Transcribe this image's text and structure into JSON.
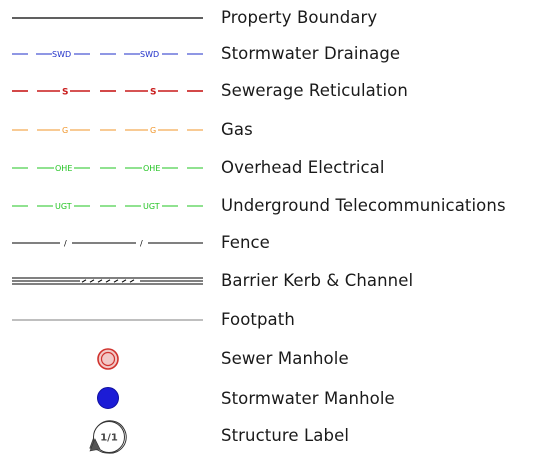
{
  "legend": {
    "items": [
      {
        "id": "property-boundary",
        "label": "Property Boundary",
        "symbol": "solid-line",
        "color": "#000000"
      },
      {
        "id": "stormwater-drainage",
        "label": "Stormwater Drainage",
        "symbol": "dashed-text-line",
        "tag": "SWD",
        "color": "#1f2fc9"
      },
      {
        "id": "sewerage-reticulation",
        "label": "Sewerage Reticulation",
        "symbol": "dashed-text-line",
        "tag": "S",
        "color": "#c81a1a"
      },
      {
        "id": "gas",
        "label": "Gas",
        "symbol": "dashed-text-line",
        "tag": "G",
        "color": "#f0962a"
      },
      {
        "id": "overhead-electrical",
        "label": "Overhead Electrical",
        "symbol": "dashed-text-line",
        "tag": "OHE",
        "color": "#22c422"
      },
      {
        "id": "underground-telecommunications",
        "label": "Underground Telecommunications",
        "symbol": "dashed-text-line",
        "tag": "UGT",
        "color": "#22c422"
      },
      {
        "id": "fence",
        "label": "Fence",
        "symbol": "fence-line",
        "tag": "/",
        "color": "#000000"
      },
      {
        "id": "barrier-kerb",
        "label": "Barrier Kerb & Channel",
        "symbol": "kerb-line",
        "color": "#000000"
      },
      {
        "id": "footpath",
        "label": "Footpath",
        "symbol": "thin-line",
        "color": "#555555"
      },
      {
        "id": "sewer-manhole",
        "label": "Sewer Manhole",
        "symbol": "sewer-manhole-icon",
        "color": "#d0332e"
      },
      {
        "id": "stormwater-manhole",
        "label": "Stormwater Manhole",
        "symbol": "stormwater-manhole-icon",
        "color": "#1c1cd6"
      },
      {
        "id": "structure-label",
        "label": "Structure Label",
        "symbol": "structure-label-icon",
        "tag": "1/1",
        "color": "#333333"
      }
    ]
  }
}
